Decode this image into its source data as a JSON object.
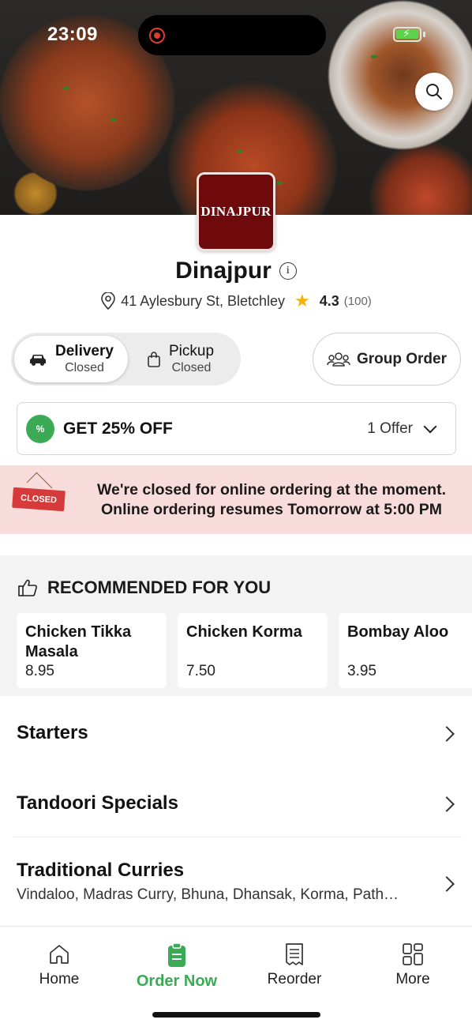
{
  "status_bar": {
    "time": "23:09"
  },
  "restaurant": {
    "logo_text": "DINAJPUR",
    "name": "Dinajpur",
    "address": "41 Aylesbury St, Bletchley",
    "rating": "4.3",
    "rating_count": "(100)"
  },
  "order_mode": {
    "delivery": {
      "title": "Delivery",
      "status": "Closed",
      "selected": true
    },
    "pickup": {
      "title": "Pickup",
      "status": "Closed",
      "selected": false
    }
  },
  "group_order": {
    "label": "Group Order"
  },
  "offer": {
    "badge": "%",
    "title": "GET 25% OFF",
    "count": "1 Offer"
  },
  "closed_notice": {
    "sign_text": "CLOSED",
    "line1": "We're closed for online ordering at the moment.",
    "line2": "Online ordering resumes Tomorrow at 5:00 PM"
  },
  "recommended": {
    "heading": "RECOMMENDED FOR YOU",
    "items": [
      {
        "name": "Chicken Tikka Masala",
        "price": "8.95"
      },
      {
        "name": "Chicken Korma",
        "price": "7.50"
      },
      {
        "name": "Bombay Aloo",
        "price": "3.95"
      }
    ]
  },
  "categories": [
    {
      "title": "Starters",
      "subtitle": ""
    },
    {
      "title": "Tandoori Specials",
      "subtitle": ""
    },
    {
      "title": "Traditional Curries",
      "subtitle": "Vindaloo, Madras Curry, Bhuna, Dhansak, Korma, Path…"
    }
  ],
  "bottom_nav": {
    "items": [
      {
        "label": "Home",
        "icon": "home-icon"
      },
      {
        "label": "Order Now",
        "icon": "order-now-icon",
        "active": true
      },
      {
        "label": "Reorder",
        "icon": "receipt-icon"
      },
      {
        "label": "More",
        "icon": "grid-icon"
      }
    ]
  },
  "colors": {
    "accent": "#3aaa55",
    "closed_banner": "#f8dcdc",
    "logo_bg": "#6e0a0c",
    "star": "#f1b400"
  }
}
